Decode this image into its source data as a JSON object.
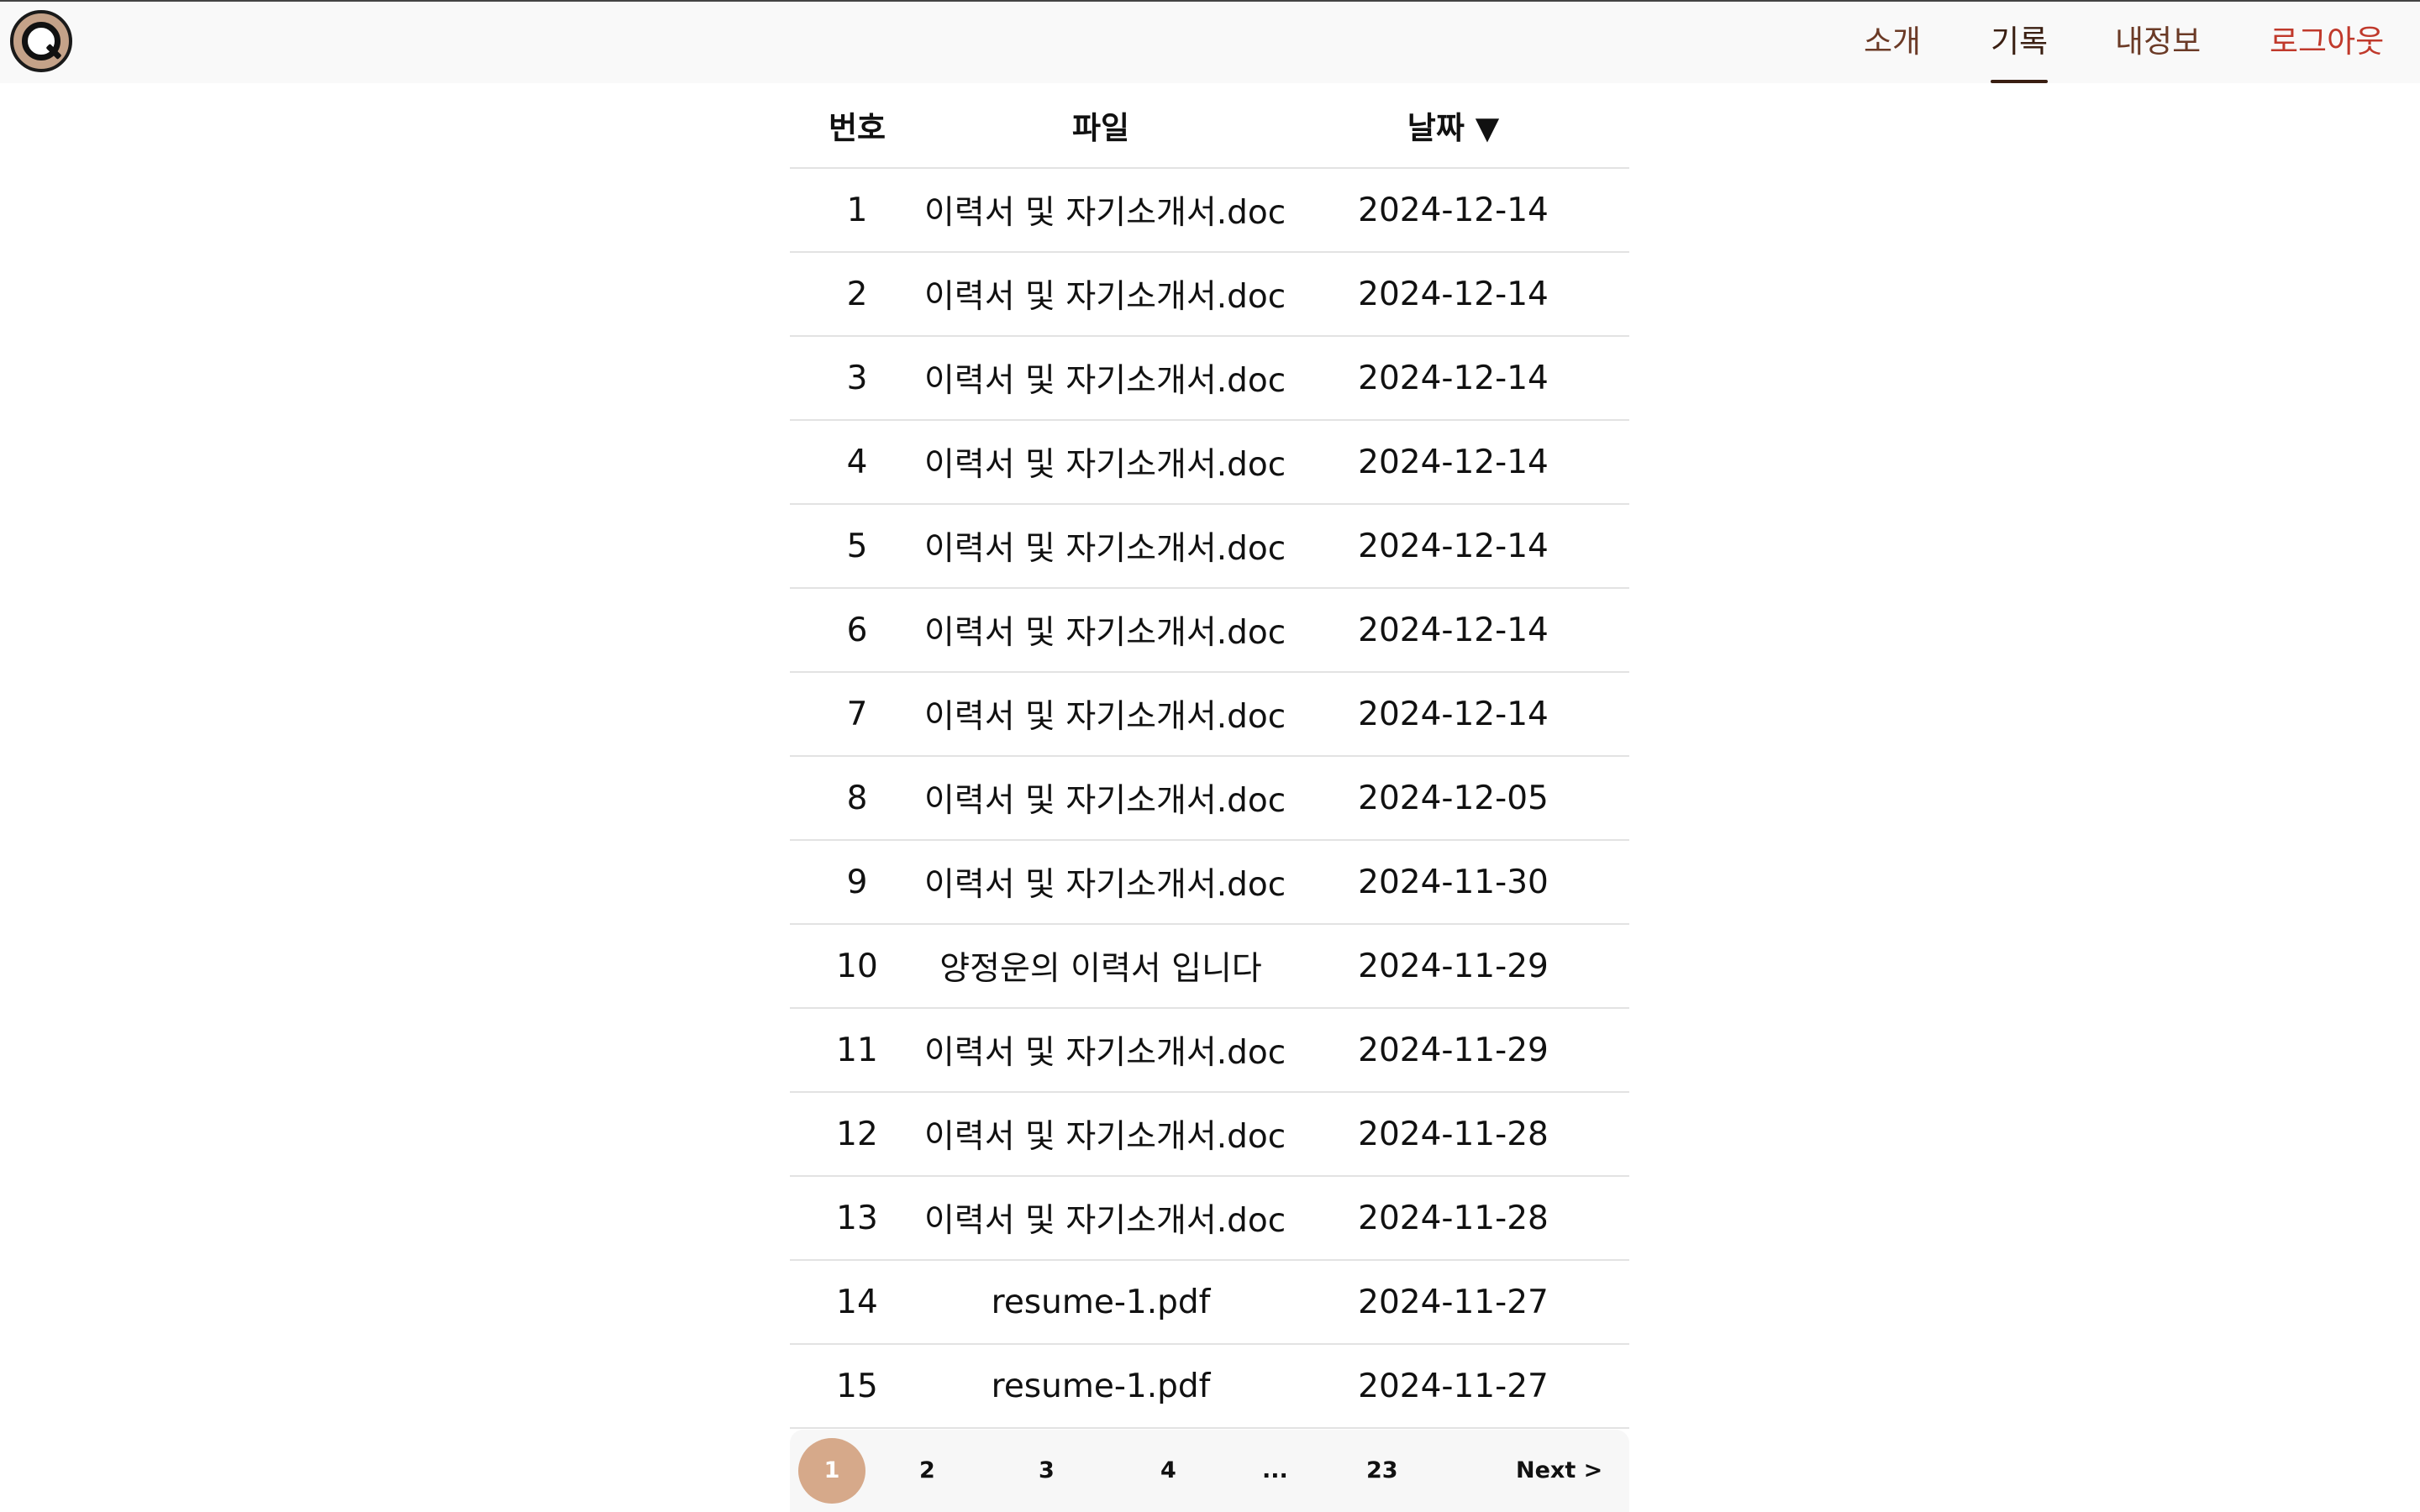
{
  "nav": {
    "items": [
      "소개",
      "기록",
      "내정보",
      "로그아웃"
    ],
    "active": "기록"
  },
  "table": {
    "headers": [
      "번호",
      "파일",
      "날짜 ▼"
    ],
    "rows": [
      [
        "1",
        "이력서 및 자기소개서.doc",
        "2024-12-14"
      ],
      [
        "2",
        "이력서 및 자기소개서.doc",
        "2024-12-14"
      ],
      [
        "3",
        "이력서 및 자기소개서.doc",
        "2024-12-14"
      ],
      [
        "4",
        "이력서 및 자기소개서.doc",
        "2024-12-14"
      ],
      [
        "5",
        "이력서 및 자기소개서.doc",
        "2024-12-14"
      ],
      [
        "6",
        "이력서 및 자기소개서.doc",
        "2024-12-14"
      ],
      [
        "7",
        "이력서 및 자기소개서.doc",
        "2024-12-14"
      ],
      [
        "8",
        "이력서 및 자기소개서.doc",
        "2024-12-05"
      ],
      [
        "9",
        "이력서 및 자기소개서.doc",
        "2024-11-30"
      ],
      [
        "10",
        "양정운의 이력서 입니다",
        "2024-11-29"
      ],
      [
        "11",
        "이력서 및 자기소개서.doc",
        "2024-11-29"
      ],
      [
        "12",
        "이력서 및 자기소개서.doc",
        "2024-11-28"
      ],
      [
        "13",
        "이력서 및 자기소개서.doc",
        "2024-11-28"
      ],
      [
        "14",
        "resume-1.pdf",
        "2024-11-27"
      ],
      [
        "15",
        "resume-1.pdf",
        "2024-11-27"
      ]
    ]
  },
  "pagination": {
    "pages": [
      "1",
      "2",
      "3",
      "4",
      "...",
      "23"
    ],
    "current": "1",
    "next_label": "Next >"
  },
  "colors": {
    "nav_text": "#6b3a26",
    "nav_active": "#3a1f12",
    "logout": "#c0392b",
    "page_current_bg": "#d6a98a"
  }
}
